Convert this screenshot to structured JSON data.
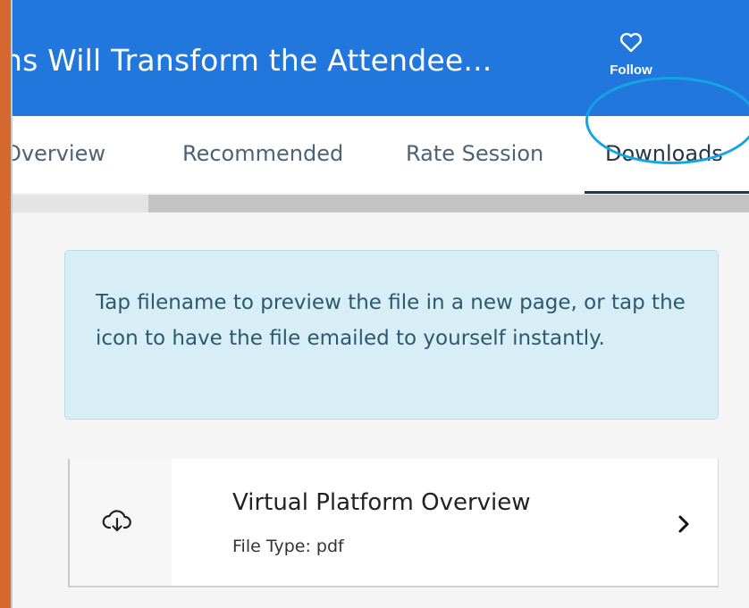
{
  "header": {
    "title": "ns Will Transform the Attendee...",
    "follow_label": "Follow",
    "background_color": "#2277dd"
  },
  "tabs": [
    {
      "label": "Overview",
      "active": false
    },
    {
      "label": "Recommended",
      "active": false
    },
    {
      "label": "Rate Session",
      "active": false
    },
    {
      "label": "Downloads",
      "active": true
    }
  ],
  "info": {
    "message": "Tap filename to preview the file in a new page, or tap the icon to have the file emailed to yourself instantly."
  },
  "files": [
    {
      "name": "Virtual Platform Overview",
      "type_text": "File Type: pdf",
      "icon": "cloud-download-icon"
    }
  ],
  "icons": {
    "follow": "heart-icon",
    "chevron": "chevron-right-icon"
  },
  "colors": {
    "highlight": "#13a5e3",
    "info_background": "#d7eef6"
  }
}
